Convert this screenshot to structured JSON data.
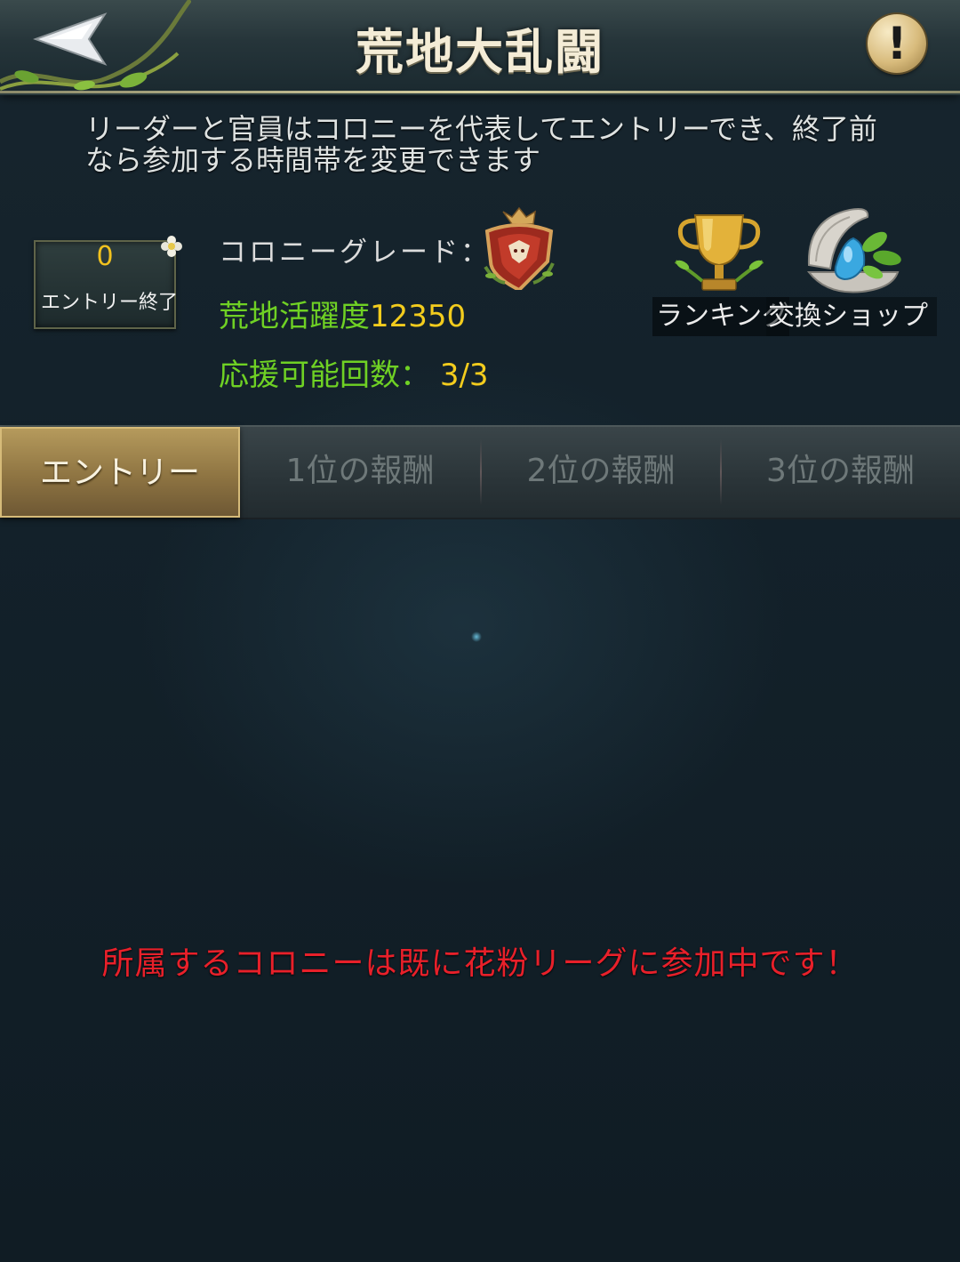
{
  "header": {
    "title": "荒地大乱闘",
    "back_icon": "back-arrow-icon",
    "info_symbol": "!",
    "info_icon": "exclamation-icon"
  },
  "description": "リーダーと官員はコロニーを代表してエントリーでき、終了前なら参加する時間帯を変更できます",
  "entry_box": {
    "count": "0",
    "status": "エントリー終了"
  },
  "colony": {
    "grade_label": "コロニーグレード：",
    "grade_icon": "colony-grade-emblem-icon",
    "activity_label": "荒地活躍度",
    "activity_value": "12350",
    "support_label": "応援可能回数：",
    "support_value": "3/3"
  },
  "actions": {
    "ranking_label": "ランキング",
    "ranking_icon": "trophy-icon",
    "shop_label": "交換ショップ",
    "shop_icon": "shell-shop-icon"
  },
  "tabs": [
    {
      "label": "エントリー",
      "active": true
    },
    {
      "label": "1位の報酬",
      "active": false
    },
    {
      "label": "2位の報酬",
      "active": false
    },
    {
      "label": "3位の報酬",
      "active": false
    }
  ],
  "message": "所属するコロニーは既に花粉リーグに参加中です！",
  "colors": {
    "accent_green": "#6fd124",
    "value_yellow": "#f3cc1d",
    "warning_red": "#e8202a",
    "tab_active_gold": "#b59a5c"
  }
}
